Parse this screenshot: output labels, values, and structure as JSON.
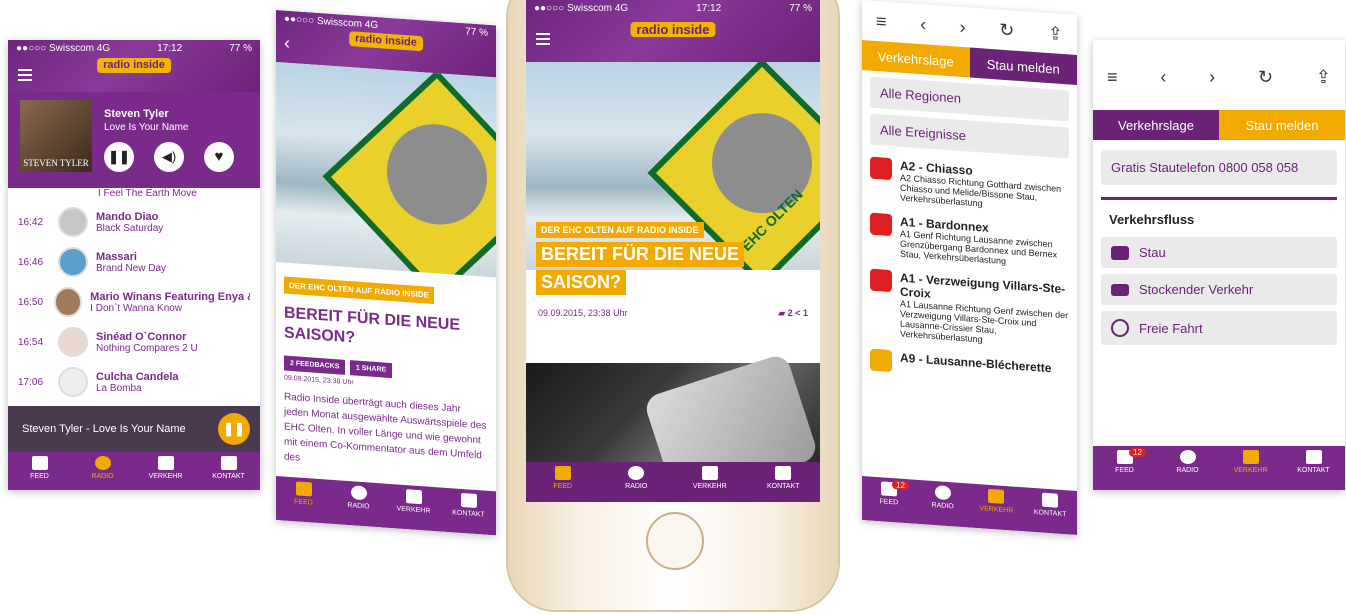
{
  "logo": "radio inside",
  "tabs": [
    "FEED",
    "RADIO",
    "VERKEHR",
    "KONTAKT"
  ],
  "p1": {
    "status": {
      "carrier": "●●○○○ Swisscom  4G",
      "time": "17:12",
      "battery": "77 %"
    },
    "now_playing": {
      "artist": "Steven Tyler",
      "title": "Love Is Your Name",
      "cover_text": "STEVEN TYLER"
    },
    "partial_top": "I Feel The Earth Move",
    "playlist": [
      {
        "time": "16:42",
        "artist": "Mando Diao",
        "title": "Black Saturday"
      },
      {
        "time": "16:46",
        "artist": "Massari",
        "title": "Brand New Day"
      },
      {
        "time": "16:50",
        "artist": "Mario Winans Featuring Enya & P",
        "title": "I Don`t Wanna Know"
      },
      {
        "time": "16:54",
        "artist": "Sinéad O`Connor",
        "title": "Nothing Compares 2 U"
      },
      {
        "time": "17:06",
        "artist": "Culcha Candela",
        "title": "La Bomba"
      }
    ],
    "footer_player": "Steven Tyler - Love Is Your Name"
  },
  "p2": {
    "status": {
      "carrier": "●●○○○ Swisscom  4G",
      "time": "17:12",
      "battery": "77 %"
    },
    "tag": "DER EHC OLTEN AUF RADIO INSIDE",
    "headline": "BEREIT FÜR DIE NEUE SAISON?",
    "feedbacks": "2 FEEDBACKS",
    "share": "1 SHARE",
    "date": "09.09.2015, 23:38 Uhr",
    "body": "Radio Inside überträgt auch dieses Jahr jeden Monat ausgewählte Auswärtsspiele des EHC Olten. In voller Länge und wie gewohnt mit einem Co-Kommentator aus dem Umfeld des"
  },
  "p3": {
    "status": {
      "carrier": "●●○○○ Swisscom  4G",
      "time": "17:12",
      "battery": "77 %"
    },
    "tag": "DER EHC OLTEN AUF RADIO INSIDE",
    "headline1": "BEREIT FÜR DIE NEUE",
    "headline2": "SAISON?",
    "date": "09.09.2015, 23:38 Uhr",
    "comments": "2",
    "shares": "1",
    "emblem": "EHC OLTEN"
  },
  "p4": {
    "segments": [
      "Verkehrslage",
      "Stau melden"
    ],
    "filters": [
      "Alle Regionen",
      "Alle Ereignisse"
    ],
    "incidents": [
      {
        "title": "A2 - Chiasso",
        "desc": "A2 Chiasso Richtung Gotthard zwischen Chiasso und Melide/Bissone Stau, Verkehrsüberlastung"
      },
      {
        "title": "A1 - Bardonnex",
        "desc": "A1 Genf Richtung Lausanne zwischen Grenzübergang Bardonnex und Bernex Stau, Verkehrsüberlastung"
      },
      {
        "title": "A1 - Verzweigung Villars-Ste-Croix",
        "desc": "A1 Lausanne Richtung Genf zwischen der Verzweigung Villars-Ste-Croix und Lausanne-Crissier Stau, Verkehrsüberlastung"
      },
      {
        "title": "A9 - Lausanne-Blécherette",
        "desc": ""
      }
    ],
    "badge": "12"
  },
  "p5": {
    "segments": [
      "Verkehrslage",
      "Stau melden"
    ],
    "hotline": "Gratis Stautelefon 0800 058 058",
    "section": "Verkehrsfluss",
    "options": [
      "Stau",
      "Stockender Verkehr",
      "Freie Fahrt"
    ],
    "badge": "12"
  }
}
